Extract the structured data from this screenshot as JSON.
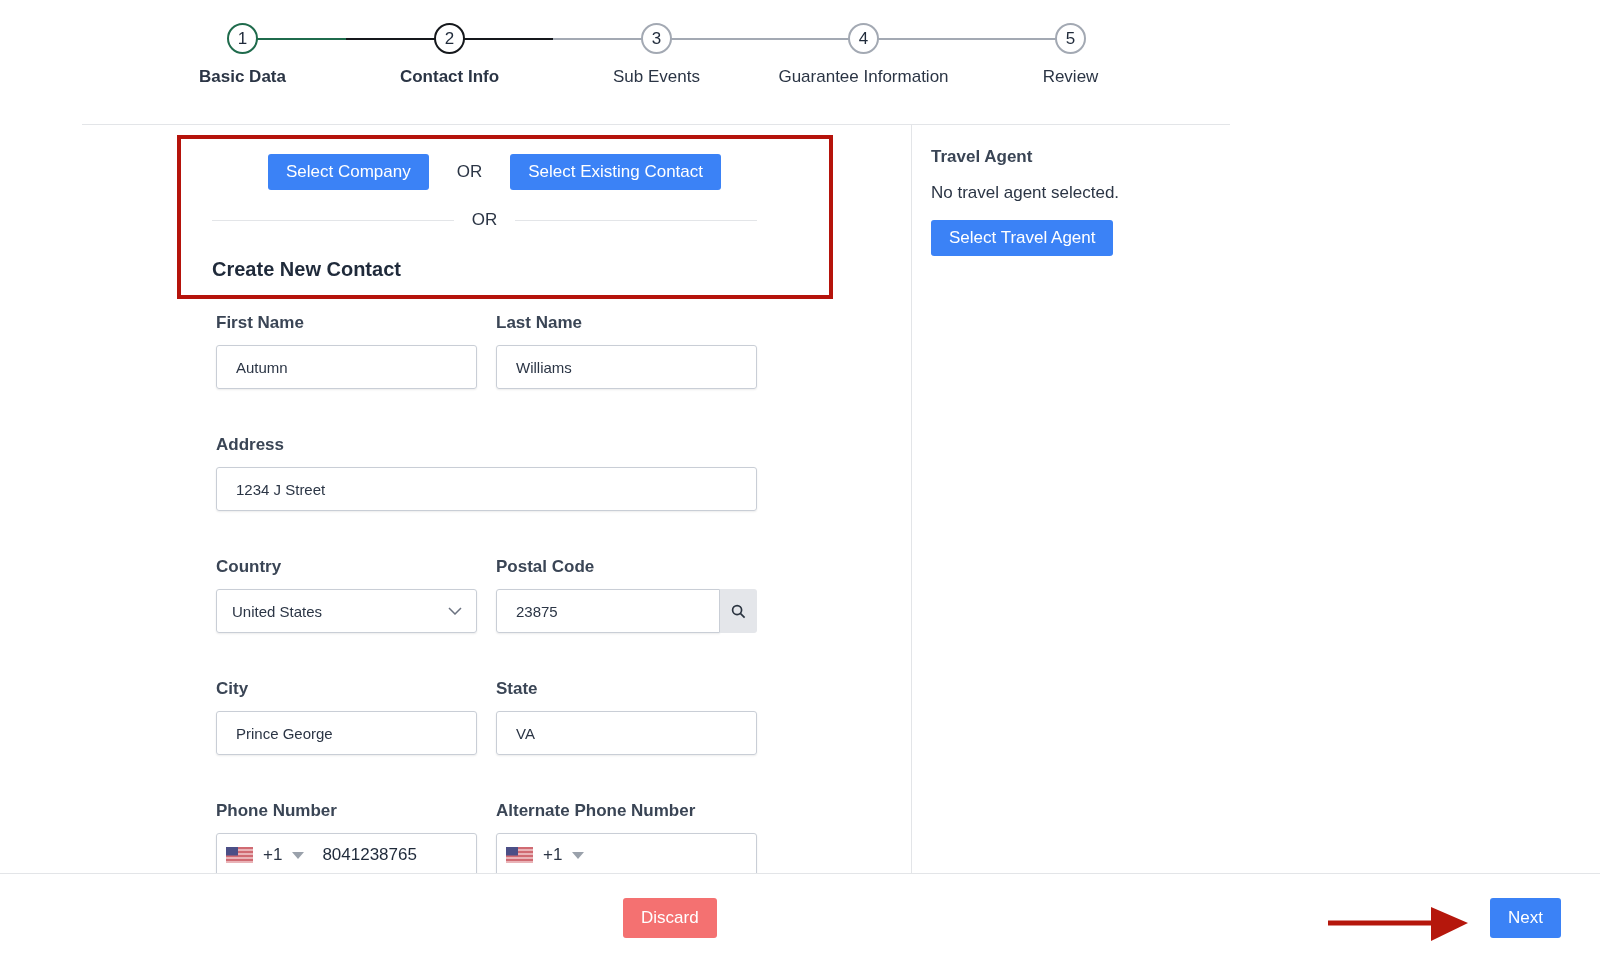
{
  "steps": [
    {
      "number": "1",
      "label": "Basic Data",
      "completed": true,
      "selected": false
    },
    {
      "number": "2",
      "label": "Contact Info",
      "completed": false,
      "selected": true
    },
    {
      "number": "3",
      "label": "Sub Events",
      "completed": false,
      "selected": false
    },
    {
      "number": "4",
      "label": "Guarantee Information",
      "completed": false,
      "selected": false
    },
    {
      "number": "5",
      "label": "Review",
      "completed": false,
      "selected": false
    }
  ],
  "contact_options": {
    "buttons": [
      "Select Company",
      "Select Existing Contact"
    ],
    "or_inline": "OR",
    "or_divider": "OR",
    "heading": "Create New Contact"
  },
  "fields": [
    {
      "label": "First Name",
      "kind": "text",
      "value": "Autumn",
      "wide": false
    },
    {
      "label": "Last Name",
      "kind": "text",
      "value": "Williams",
      "wide": false
    },
    {
      "label": "Address",
      "kind": "text",
      "value": "1234 J Street",
      "wide": true
    },
    {
      "label": "Country",
      "kind": "select",
      "value": "United States",
      "wide": false
    },
    {
      "label": "Postal Code",
      "kind": "search",
      "value": "23875",
      "wide": false
    },
    {
      "label": "City",
      "kind": "text",
      "value": "Prince George",
      "wide": false
    },
    {
      "label": "State",
      "kind": "text",
      "value": "VA",
      "wide": false
    },
    {
      "label": "Phone Number",
      "kind": "phone",
      "code": "+1",
      "value": "8041238765",
      "wide": false
    },
    {
      "label": "Alternate Phone Number",
      "kind": "phone",
      "code": "+1",
      "wide": false
    }
  ],
  "travel_agent": {
    "title": "Travel Agent",
    "message": "No travel agent selected.",
    "button": "Select Travel Agent"
  },
  "footer": {
    "discard": "Discard",
    "next": "Next"
  }
}
